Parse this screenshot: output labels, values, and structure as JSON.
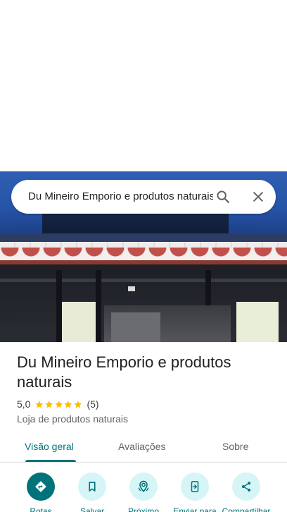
{
  "search": {
    "query": "Du Mineiro Emporio e produtos naturais"
  },
  "place": {
    "name": "Du Mineiro Emporio e produtos naturais",
    "rating": "5,0",
    "rating_value": 5.0,
    "review_count": "(5)",
    "category": "Loja de produtos naturais"
  },
  "tabs": [
    {
      "label": "Visão geral",
      "active": true
    },
    {
      "label": "Avaliações",
      "active": false
    },
    {
      "label": "Sobre",
      "active": false
    }
  ],
  "actions": [
    {
      "label": "Rotas",
      "icon": "directions-icon"
    },
    {
      "label": "Salvar",
      "icon": "bookmark-icon"
    },
    {
      "label": "Próximo",
      "icon": "nearby-icon"
    },
    {
      "label": "Enviar para",
      "icon": "send-to-phone-icon"
    },
    {
      "label": "Compartilhar",
      "icon": "share-icon"
    }
  ],
  "colors": {
    "accent": "#00737a",
    "accent_light": "#d6f5f6",
    "star": "#fbbc04"
  }
}
